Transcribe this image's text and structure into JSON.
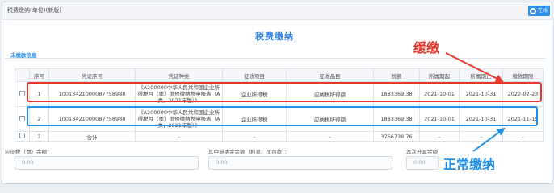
{
  "header": {
    "breadcrumb": "税费缴纳(单位)(新版)",
    "online_label": "在线"
  },
  "title": "税费缴纳",
  "section_title": "未缴款信息",
  "annotations": {
    "late_label": "缓缴",
    "normal_label": "正常缴纳"
  },
  "table": {
    "headers": [
      "",
      "序号",
      "凭证序号",
      "凭证种类",
      "征收项目",
      "征收品目",
      "税额",
      "所属期起",
      "所属期止",
      "缴款期限"
    ],
    "rows": [
      {
        "seq": "1",
        "voucher_no": "10013421000087758988",
        "voucher_type": "《A200000中华人民共和国企业所得税月（季）度预缴纳税申报表（A类，2021年版）》",
        "project": "企业所得税",
        "item": "应纳税所得额",
        "amount": "1883369.38",
        "start": "2021-10-01",
        "end": "2021-10-31",
        "deadline": "2022-02-23"
      },
      {
        "seq": "2",
        "voucher_no": "10013421000087758988",
        "voucher_type": "《A200000中华人民共和国企业所得税月（季）度预缴纳税申报表（A类，2021年版）》",
        "project": "企业所得税",
        "item": "应纳税所得额",
        "amount": "1883369.38",
        "start": "2021-10-01",
        "end": "2021-10-31",
        "deadline": "2021-11-15"
      },
      {
        "seq": "3",
        "voucher_no": "合计",
        "voucher_type": "-",
        "project": "-",
        "item": "-",
        "amount": "3766738.76",
        "start": "-",
        "end": "-",
        "deadline": "-"
      }
    ]
  },
  "summary": {
    "due_label": "应征税（费）金额：",
    "due_value": "0.00",
    "surcharge_label": "其中滞纳金金额（利息、加罚款）：",
    "surcharge_value": "0.00",
    "current_label": "本次开具金额：",
    "current_value": "0.00"
  },
  "colors": {
    "accent": "#2d8ff0",
    "late": "#e7362c",
    "normal": "#1e90e6"
  }
}
